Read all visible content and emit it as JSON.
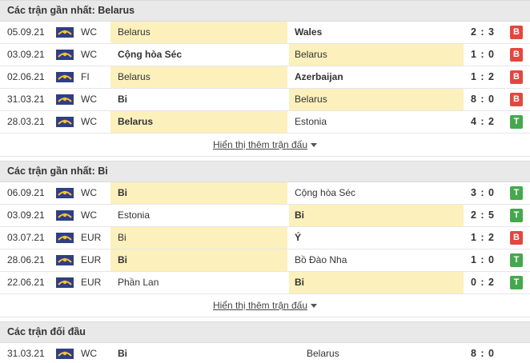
{
  "sections": [
    {
      "title": "Các trận gần nhất: Belarus",
      "more_label": "Hiển thị thêm trận đấu",
      "rows": [
        {
          "date": "05.09.21",
          "comp": "WC",
          "home": "Belarus",
          "away": "Wales",
          "score": "2 : 3",
          "result": "B"
        },
        {
          "date": "03.09.21",
          "comp": "WC",
          "home": "Cộng hòa Séc",
          "away": "Belarus",
          "score": "1 : 0",
          "result": "B"
        },
        {
          "date": "02.06.21",
          "comp": "FI",
          "home": "Belarus",
          "away": "Azerbaijan",
          "score": "1 : 2",
          "result": "B"
        },
        {
          "date": "31.03.21",
          "comp": "WC",
          "home": "Bi",
          "away": "Belarus",
          "score": "8 : 0",
          "result": "B"
        },
        {
          "date": "28.03.21",
          "comp": "WC",
          "home": "Belarus",
          "away": "Estonia",
          "score": "4 : 2",
          "result": "T"
        }
      ]
    },
    {
      "title": "Các trận gần nhất: Bi",
      "more_label": "Hiển thị thêm trận đấu",
      "rows": [
        {
          "date": "06.09.21",
          "comp": "WC",
          "home": "Bi",
          "away": "Cộng hòa Séc",
          "score": "3 : 0",
          "result": "T"
        },
        {
          "date": "03.09.21",
          "comp": "WC",
          "home": "Estonia",
          "away": "Bi",
          "score": "2 : 5",
          "result": "T"
        },
        {
          "date": "03.07.21",
          "comp": "EUR",
          "home": "Bi",
          "away": "Ý",
          "score": "1 : 2",
          "result": "B"
        },
        {
          "date": "28.06.21",
          "comp": "EUR",
          "home": "Bi",
          "away": "Bồ Đào Nha",
          "score": "1 : 0",
          "result": "T"
        },
        {
          "date": "22.06.21",
          "comp": "EUR",
          "home": "Phần Lan",
          "away": "Bi",
          "score": "0 : 2",
          "result": "T"
        }
      ]
    }
  ],
  "h2h": {
    "title": "Các trận đối đầu",
    "rows": [
      {
        "date": "31.03.21",
        "comp": "WC",
        "home": "Bi",
        "away": "Belarus",
        "score": "8 : 0"
      }
    ]
  },
  "colors": {
    "highlight": "#fcf0bd",
    "loss_badge": "#e4473f",
    "win_badge": "#46a84e",
    "header_bg": "#e9e9e9"
  }
}
